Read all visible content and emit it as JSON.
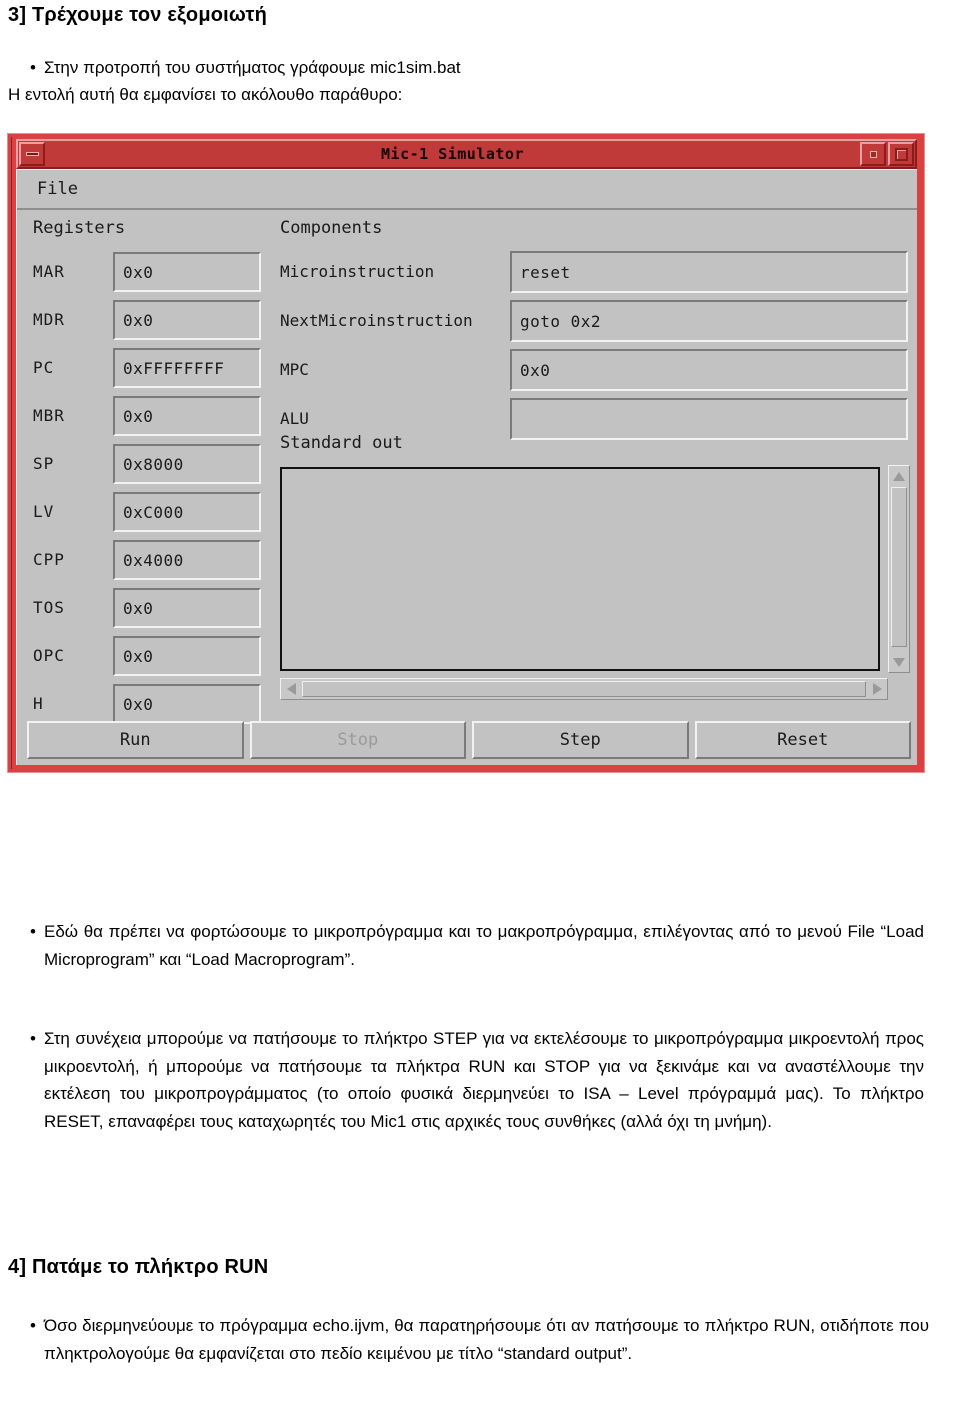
{
  "document": {
    "section3_heading": "3] Τρέχουμε τον εξομοιωτή",
    "bullet1": "Στην προτροπή του συστήματος γράφουμε mic1sim.bat",
    "line_after_bullet1": "Η εντολή αυτή θα εμφανίσει το ακόλουθο παράθυρο:",
    "bullet2": "Εδώ θα πρέπει να φορτώσουμε το μικροπρόγραμμα και το μακροπρόγραμμα, επιλέγοντας από το μενού File “Load Microprogram” και “Load Macroprogram”.",
    "bullet3": "Στη συνέχεια μπορούμε να πατήσουμε το πλήκτρο STEP για να εκτελέσουμε το μικροπρόγραμμα μικροεντολή προς μικροεντολή, ή μπορούμε να πατήσουμε τα πλήκτρα RUN και STOP για να ξεκινάμε και να αναστέλλουμε την εκτέλεση του μικροπρογράμματος (το οποίο φυσικά διερμηνεύει το ISA – Level πρόγραμμά μας). Το πλήκτρο RESET, επαναφέρει τους καταχωρητές του Mic1 στις αρχικές τους συνθήκες (αλλά όχι τη μνήμη).",
    "section4_heading": "4] Πατάμε το πλήκτρο RUN",
    "bullet4": "Όσο διερμηνεύουμε το πρόγραμμα echo.ijvm, θα παρατηρήσουμε ότι αν πατήσουμε το πλήκτρο RUN, οτιδήποτε που πληκτρολογούμε θα εμφανίζεται στο πεδίο κειμένου με τίτλο “standard output”.",
    "bullet_glyph": "•"
  },
  "simulator": {
    "title": "Mic-1 Simulator",
    "titlebar": {
      "minimize_icon": "minimize-icon",
      "restore_icon": "restore-icon",
      "maximize_icon": "maximize-icon"
    },
    "menu": {
      "file": "File"
    },
    "groups": {
      "registers": "Registers",
      "components": "Components",
      "standard_out": "Standard out"
    },
    "registers": [
      {
        "name": "MAR",
        "value": "0x0"
      },
      {
        "name": "MDR",
        "value": "0x0"
      },
      {
        "name": "PC",
        "value": "0xFFFFFFFF"
      },
      {
        "name": "MBR",
        "value": "0x0"
      },
      {
        "name": "SP",
        "value": "0x8000"
      },
      {
        "name": "LV",
        "value": "0xC000"
      },
      {
        "name": "CPP",
        "value": "0x4000"
      },
      {
        "name": "TOS",
        "value": "0x0"
      },
      {
        "name": "OPC",
        "value": "0x0"
      },
      {
        "name": "H",
        "value": "0x0"
      }
    ],
    "components": [
      {
        "name": "Microinstruction",
        "value": "reset"
      },
      {
        "name": "NextMicroinstruction",
        "value": "goto 0x2"
      },
      {
        "name": "MPC",
        "value": "0x0"
      },
      {
        "name": "ALU",
        "value": ""
      }
    ],
    "standard_out_value": "",
    "buttons": [
      {
        "label": "Run",
        "disabled": false
      },
      {
        "label": "Stop",
        "disabled": true
      },
      {
        "label": "Step",
        "disabled": false
      },
      {
        "label": "Reset",
        "disabled": false
      }
    ],
    "colors": {
      "frame_red": "#d94242",
      "titlebar_red": "#c03a3a",
      "panel_grey": "#c2c2c2"
    }
  }
}
